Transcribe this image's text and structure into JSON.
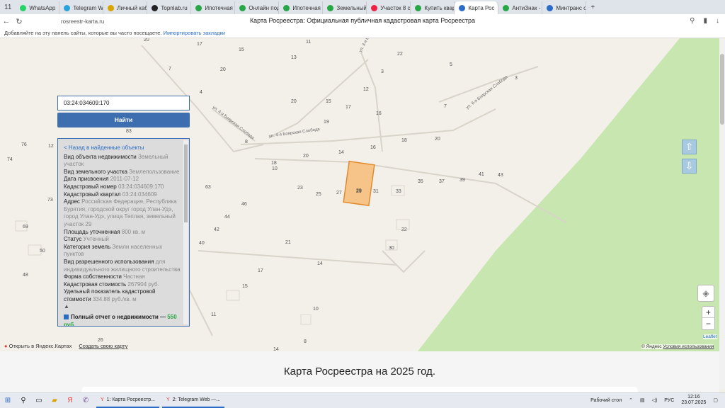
{
  "browser": {
    "tab_controls": [
      "11",
      "≡"
    ],
    "tabs": [
      {
        "label": "WhatsApp",
        "icon": "whatsapp-icon",
        "color": "#25d366"
      },
      {
        "label": "Telegram We",
        "icon": "telegram-icon",
        "color": "#2aa3dc"
      },
      {
        "label": "Личный кабі",
        "icon": "bank-icon",
        "color": "#d9a400"
      },
      {
        "label": "Topnlab.ru",
        "icon": "topnlab-icon",
        "color": "#222222"
      },
      {
        "label": "Ипотечная",
        "icon": "chat-icon",
        "color": "#25a745"
      },
      {
        "label": "Онлайн под",
        "icon": "chat-icon",
        "color": "#25a745"
      },
      {
        "label": "Ипотечная",
        "icon": "chat-icon",
        "color": "#25a745"
      },
      {
        "label": "Земельный",
        "icon": "chat-icon",
        "color": "#25a745"
      },
      {
        "label": "Участок 8 со",
        "icon": "avito-icon",
        "color": "#e24"
      },
      {
        "label": "Купить квар",
        "icon": "domclick-icon",
        "color": "#25a745"
      },
      {
        "label": "Карта Рос",
        "icon": "rosreestr-icon",
        "color": "#2a6cc7",
        "active": true
      },
      {
        "label": "АнтиЗнак -",
        "icon": "antiznak-icon",
        "color": "#25a745"
      },
      {
        "label": "Минтранс о",
        "icon": "mintrans-icon",
        "color": "#2a6cc7"
      }
    ],
    "new_tab": "+",
    "url": "rosreestr-karta.ru",
    "page_title": "Карта Росреестра: Официальная публичная кадастровая карта Росреестра",
    "bookmarks_text": "Добавляйте на эту панель сайты, которые вы часто посещаете.",
    "bookmarks_link": "Импортировать закладки"
  },
  "search": {
    "value": "03:24:034609:170",
    "button": "Найти"
  },
  "info": {
    "back": "< Назад в найденные объекты",
    "rows": [
      {
        "label": "Вид объекта недвижимости",
        "value": "Земельный участок"
      },
      {
        "label": "Вид земельного участка",
        "value": "Землепользование"
      },
      {
        "label": "Дата присвоения",
        "value": "2011-07-12"
      },
      {
        "label": "Кадастровый номер",
        "value": "03:24:034609:170"
      },
      {
        "label": "Кадастровый квартал",
        "value": "03:24:034609"
      },
      {
        "label": "Адрес",
        "value": "Российская Федерация, Республика Бурятия, городской округ город Улан-Удэ, город Улан-Удэ, улица Теплая, земельный участок 29"
      },
      {
        "label": "Площадь уточненная",
        "value": "800 кв. м"
      },
      {
        "label": "Статус",
        "value": "Учтенный"
      },
      {
        "label": "Категория земель",
        "value": "Земли населенных пунктов"
      },
      {
        "label": "Вид разрешенного использования",
        "value": "для индивидуального жилищного строительства"
      },
      {
        "label": "Форма собственности",
        "value": "Частная"
      },
      {
        "label": "Кадастровая стоимость",
        "value": "267904 руб."
      },
      {
        "label": "Удельный показатель кадастровой стоимости",
        "value": "334.88 руб./кв. м"
      }
    ],
    "collapse": "▲",
    "report_label": "Полный отчет о недвижимости —",
    "report_price": "550",
    "report_currency": "руб."
  },
  "map": {
    "streets": [
      "ул. 3-я Боярская Слобода",
      "ул. 4-я Боярская Слобода",
      "ул. 4-я Боярская Слобода",
      "ул. 6-я Боярская Слобода"
    ],
    "numbers": [
      "20",
      "17",
      "15",
      "11",
      "22",
      "20",
      "13",
      "3",
      "5",
      "3",
      "4",
      "20",
      "12",
      "15",
      "17",
      "16",
      "7",
      "19",
      "18",
      "20",
      "83",
      "8",
      "14",
      "16",
      "18",
      "20",
      "76",
      "74",
      "12",
      "10",
      "23",
      "25",
      "27",
      "29",
      "31",
      "33",
      "35",
      "37",
      "39",
      "41",
      "43",
      "7",
      "73",
      "63",
      "46",
      "44",
      "42",
      "69",
      "40",
      "50",
      "21",
      "22",
      "48",
      "30",
      "14",
      "17",
      "15",
      "10",
      "11",
      "8",
      "14",
      "26"
    ],
    "selected_parcel": "29",
    "green_color": "#c8e6b0"
  },
  "controls": {
    "up_arrow": "⇧",
    "down_arrow": "⇩",
    "zoom_in": "+",
    "zoom_out": "−",
    "layers_icon": "layers-icon",
    "leaflet": "Leaflet",
    "open_yandex": "Открыть в Яндекс.Картах",
    "create_map": "Создать свою карту",
    "copyright_prefix": "© Яндекс",
    "copyright_link": "Условия использования"
  },
  "footer": {
    "heading": "Карта Росреестра на 2025 год."
  },
  "taskbar": {
    "tasks": [
      "1: Карта Росреестр...",
      "2: Telegram Web —..."
    ],
    "desktop": "Рабочий стол",
    "lang": "РУС",
    "time": "12:16",
    "date": "23.07.2025"
  }
}
